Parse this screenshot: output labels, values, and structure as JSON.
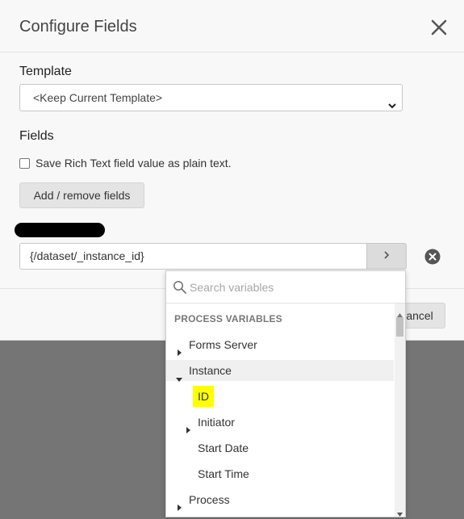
{
  "dialog": {
    "title": "Configure Fields",
    "close_icon": "close-icon",
    "template_label": "Template",
    "template_value": "<Keep Current Template>",
    "fields_label": "Fields",
    "checkbox_label": "Save Rich Text field value as plain text.",
    "checkbox_checked": false,
    "add_remove_label": "Add / remove fields",
    "field_value": "{/dataset/_instance_id}",
    "cancel_label": "Cancel",
    "cancel_visible_text": "ancel"
  },
  "variables_panel": {
    "search_placeholder": "Search variables",
    "heading": "PROCESS VARIABLES",
    "items": [
      {
        "label": "Forms Server",
        "level": 0,
        "caret": "right"
      },
      {
        "label": "Instance",
        "level": 0,
        "caret": "down",
        "active": true
      },
      {
        "label": "ID",
        "level": 1,
        "caret": "none",
        "highlighted": true
      },
      {
        "label": "Initiator",
        "level": 1,
        "caret": "right"
      },
      {
        "label": "Start Date",
        "level": 1,
        "caret": "none"
      },
      {
        "label": "Start Time",
        "level": 1,
        "caret": "none"
      },
      {
        "label": "Process",
        "level": 0,
        "caret": "right"
      }
    ]
  },
  "colors": {
    "highlight": "#ffff00",
    "backdrop": "#757575"
  }
}
